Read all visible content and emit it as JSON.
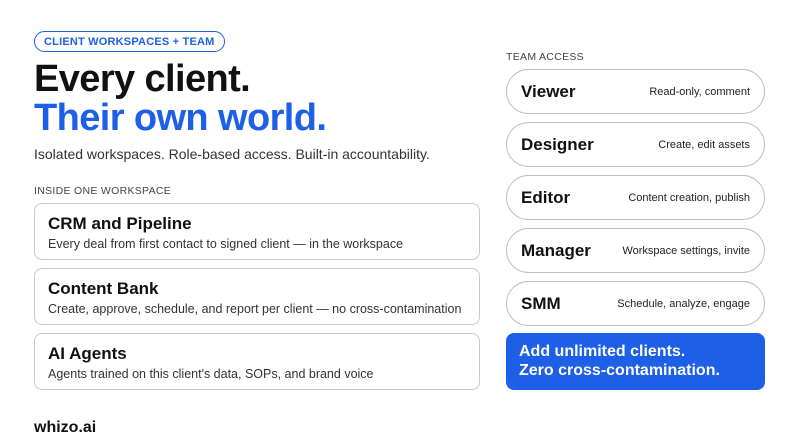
{
  "tag": "CLIENT WORKSPACES + TEAM",
  "headline": {
    "line1": "Every client.",
    "line2": "Their own world."
  },
  "subline": "Isolated workspaces. Role-based access. Built-in accountability.",
  "workspace": {
    "label": "INSIDE ONE WORKSPACE",
    "items": [
      {
        "title": "CRM and Pipeline",
        "desc": "Every deal from first contact to signed client — in the workspace"
      },
      {
        "title": "Content Bank",
        "desc": "Create, approve, schedule, and report per client — no cross-contamination"
      },
      {
        "title": "AI Agents",
        "desc": "Agents trained on this client's data, SOPs, and brand voice"
      }
    ]
  },
  "team": {
    "label": "TEAM ACCESS",
    "roles": [
      {
        "name": "Viewer",
        "desc": "Read-only, comment"
      },
      {
        "name": "Designer",
        "desc": "Create, edit assets"
      },
      {
        "name": "Editor",
        "desc": "Content creation, publish"
      },
      {
        "name": "Manager",
        "desc": "Workspace settings, invite"
      },
      {
        "name": "SMM",
        "desc": "Schedule, analyze, engage"
      }
    ]
  },
  "cta": {
    "line1": "Add unlimited clients.",
    "line2": "Zero cross-contamination."
  },
  "brand": "whizo.ai",
  "colors": {
    "accent": "#1d5fe6",
    "text": "#111111",
    "border": "#c9c9c9"
  }
}
